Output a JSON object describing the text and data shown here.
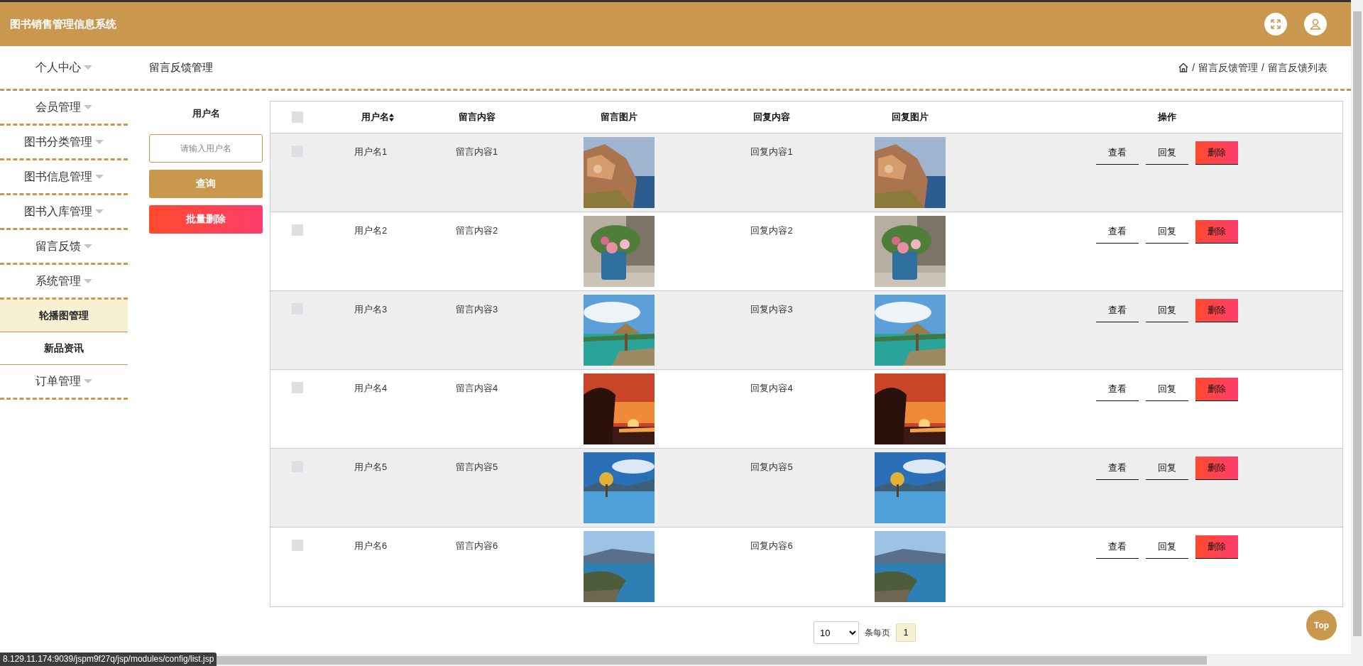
{
  "header": {
    "title": "图书销售管理信息系统"
  },
  "sidebar": {
    "items": [
      {
        "label": "个人中心"
      },
      {
        "label": "会员管理"
      },
      {
        "label": "图书分类管理"
      },
      {
        "label": "图书信息管理"
      },
      {
        "label": "图书入库管理"
      },
      {
        "label": "留言反馈"
      },
      {
        "label": "系统管理",
        "children": [
          {
            "label": "轮播图管理",
            "selected": true
          },
          {
            "label": "新品资讯",
            "selected": false
          }
        ]
      },
      {
        "label": "订单管理"
      }
    ]
  },
  "page": {
    "title": "留言反馈管理",
    "breadcrumb": [
      {
        "separator": "/",
        "label": "留言反馈管理"
      },
      {
        "separator": "/",
        "label": "留言反馈列表"
      }
    ]
  },
  "search": {
    "label": "用户名",
    "placeholder": "请输入用户名",
    "buttons": [
      {
        "label": "查询",
        "kind": "query"
      },
      {
        "label": "批量删除",
        "kind": "danger"
      }
    ]
  },
  "table": {
    "select_all": {
      "checked": false
    },
    "columns": [
      "用户名",
      "留言内容",
      "留言图片",
      "回复内容",
      "回复图片",
      "操作"
    ],
    "rows": [
      {
        "checked": false,
        "username": "用户名1",
        "content": "留言内容1",
        "reply": "回复内容1",
        "actions": [
          "查看",
          "回复",
          "删除"
        ]
      },
      {
        "checked": false,
        "username": "用户名2",
        "content": "留言内容2",
        "reply": "回复内容2",
        "actions": [
          "查看",
          "回复",
          "删除"
        ]
      },
      {
        "checked": false,
        "username": "用户名3",
        "content": "留言内容3",
        "reply": "回复内容3",
        "actions": [
          "查看",
          "回复",
          "删除"
        ]
      },
      {
        "checked": false,
        "username": "用户名4",
        "content": "留言内容4",
        "reply": "回复内容4",
        "actions": [
          "查看",
          "回复",
          "删除"
        ]
      },
      {
        "checked": false,
        "username": "用户名5",
        "content": "留言内容5",
        "reply": "回复内容5",
        "actions": [
          "查看",
          "回复",
          "删除"
        ]
      },
      {
        "checked": false,
        "username": "用户名6",
        "content": "留言内容6",
        "reply": "回复内容6",
        "actions": [
          "查看",
          "回复",
          "删除"
        ]
      }
    ]
  },
  "pagination": {
    "page_size": "10",
    "per_page_label": "条每页",
    "pages": [
      {
        "label": "1",
        "selected": true
      }
    ]
  },
  "top_button": "Top",
  "status_url": "8.129.11.174:9039/jspm9f27q/jsp/modules/config/list.jsp"
}
